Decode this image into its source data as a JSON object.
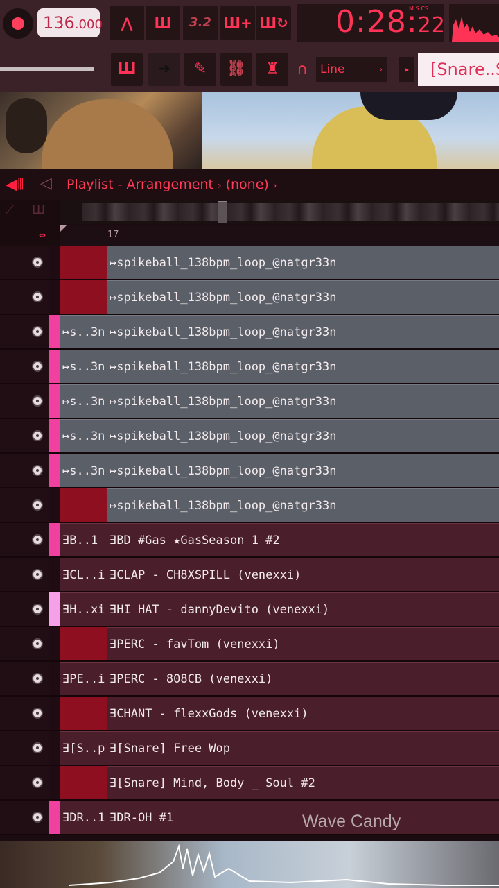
{
  "toolbar": {
    "tempo_whole": "136",
    "tempo_frac": ".000",
    "time_main": "0:28",
    "time_cs": "22",
    "time_unit": "M:S:CS",
    "snap_label": "Line",
    "pattern_name": "[Snare..So",
    "step_label": "3.2"
  },
  "playlist": {
    "title": "Playlist - Arrangement",
    "sep1": "›",
    "pattern": "(none)",
    "sep2": "›",
    "ruler_bar": "17"
  },
  "tracks": [
    {
      "strip": "#1e0c12",
      "left": "",
      "left_type": "red",
      "name": "↦spikeball_138bpm_loop_@natgr33n",
      "type": "audio"
    },
    {
      "strip": "#1e0c12",
      "left": "",
      "left_type": "red",
      "name": "↦spikeball_138bpm_loop_@natgr33n",
      "type": "audio"
    },
    {
      "strip": "#f040a0",
      "left": "↦s..3n",
      "left_type": "audio",
      "name": "↦spikeball_138bpm_loop_@natgr33n",
      "type": "audio"
    },
    {
      "strip": "#f040a0",
      "left": "↦s..3n",
      "left_type": "audio",
      "name": "↦spikeball_138bpm_loop_@natgr33n",
      "type": "audio"
    },
    {
      "strip": "#f040a0",
      "left": "↦s..3n",
      "left_type": "audio",
      "name": "↦spikeball_138bpm_loop_@natgr33n",
      "type": "audio"
    },
    {
      "strip": "#f040a0",
      "left": "↦s..3n",
      "left_type": "audio",
      "name": "↦spikeball_138bpm_loop_@natgr33n",
      "type": "audio"
    },
    {
      "strip": "#f040a0",
      "left": "↦s..3n",
      "left_type": "audio",
      "name": "↦spikeball_138bpm_loop_@natgr33n",
      "type": "audio"
    },
    {
      "strip": "#1e0c12",
      "left": "",
      "left_type": "red",
      "name": "↦spikeball_138bpm_loop_@natgr33n",
      "type": "audio"
    },
    {
      "strip": "#f040a0",
      "left": "∃B..1",
      "left_type": "pattern",
      "name": "∃BD #Gas ★GasSeason 1 #2",
      "type": "pattern"
    },
    {
      "strip": "#1e0c12",
      "left": "∃CL..i)",
      "left_type": "pattern",
      "name": "∃CLAP - CH8XSPILL (venexxi)",
      "type": "pattern"
    },
    {
      "strip": "#f5a0e8",
      "left": "∃H..xi)",
      "left_type": "pattern",
      "name": "∃HI HAT - dannyDevito (venexxi)",
      "type": "pattern"
    },
    {
      "strip": "#1e0c12",
      "left": "",
      "left_type": "red",
      "name": "∃PERC - favTom (venexxi)",
      "type": "pattern"
    },
    {
      "strip": "#1e0c12",
      "left": "∃PE..i)",
      "left_type": "pattern",
      "name": "∃PERC - 808CB (venexxi)",
      "type": "pattern"
    },
    {
      "strip": "#1e0c12",
      "left": "",
      "left_type": "red",
      "name": "∃CHANT - flexxGods (venexxi)",
      "type": "pattern"
    },
    {
      "strip": "#1e0c12",
      "left": "∃[S..p",
      "left_type": "pattern",
      "name": "∃[Snare] Free Wop",
      "type": "pattern"
    },
    {
      "strip": "#1e0c12",
      "left": "",
      "left_type": "red",
      "name": "∃[Snare] Mind, Body _ Soul #2",
      "type": "pattern"
    },
    {
      "strip": "#f040a0",
      "left": "∃DR..1",
      "left_type": "pattern",
      "name": "∃DR-OH #1",
      "type": "pattern"
    }
  ],
  "overlay_label": "Wave Candy",
  "colors": {
    "accent": "#ff3355",
    "audio_clip": "#5b5f68",
    "pattern_clip": "#4a1e2a",
    "red_cell": "#8d0f20"
  },
  "icons": [
    "record-icon",
    "metronome-icon",
    "wait-record-icon",
    "step-edit-icon",
    "add-pattern-icon",
    "loop-record-icon",
    "piano-roll-icon",
    "arrow-icon",
    "brush-icon",
    "link-icon",
    "magnet-icon",
    "speaker-icon"
  ]
}
